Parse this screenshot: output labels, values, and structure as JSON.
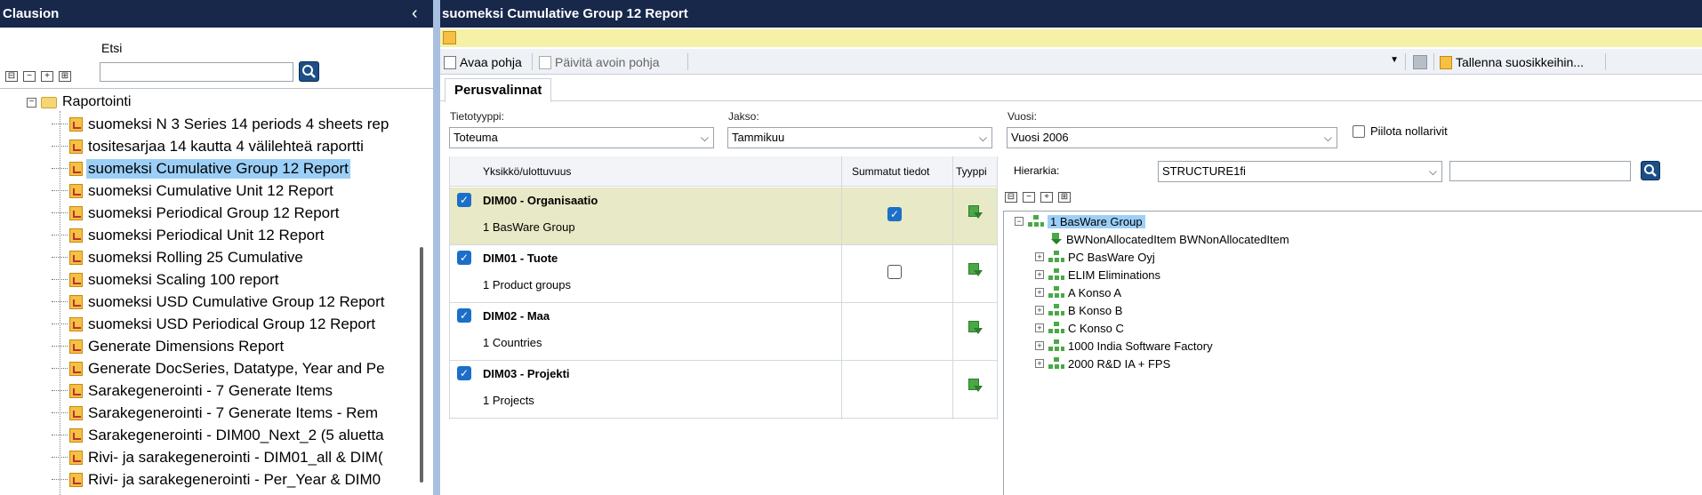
{
  "left_panel": {
    "title": "Clausion",
    "search_label": "Etsi",
    "search_value": "",
    "tree_root": "Raportointi",
    "tree_items": [
      {
        "label": "suomeksi N 3 Series 14 periods 4 sheets rep"
      },
      {
        "label": " tositesarjaa 14 kautta 4 välilehteä raportti"
      },
      {
        "label": "suomeksi Cumulative Group 12 Report",
        "selected": true
      },
      {
        "label": "suomeksi Cumulative Unit 12 Report"
      },
      {
        "label": "suomeksi Periodical Group 12 Report"
      },
      {
        "label": "suomeksi Periodical Unit 12 Report"
      },
      {
        "label": "suomeksi Rolling 25 Cumulative"
      },
      {
        "label": "suomeksi Scaling 100 report"
      },
      {
        "label": "suomeksi USD Cumulative Group 12 Report"
      },
      {
        "label": "suomeksi USD Periodical Group 12 Report"
      },
      {
        "label": "Generate Dimensions Report"
      },
      {
        "label": "Generate DocSeries, Datatype, Year and Pe"
      },
      {
        "label": "Sarakegenerointi - 7 Generate Items"
      },
      {
        "label": "Sarakegenerointi - 7 Generate Items -   Rem"
      },
      {
        "label": "Sarakegenerointi - DIM00_Next_2 (5 aluetta"
      },
      {
        "label": "Rivi- ja sarakegenerointi - DIM01_all & DIM("
      },
      {
        "label": "Rivi- ja sarakegenerointi - Per_Year & DIM0"
      }
    ]
  },
  "right_panel": {
    "title": "suomeksi Cumulative Group 12 Report",
    "toolbar": {
      "open_label": "Avaa pohja",
      "update_label": "Päivitä avoin pohja",
      "save_fav_label": "Tallenna suosikkeihin..."
    },
    "tab_label": "Perusvalinnat",
    "fields": {
      "datatype_label": "Tietotyyppi:",
      "datatype_value": "Toteuma",
      "period_label": "Jakso:",
      "period_value": "Tammikuu",
      "year_label": "Vuosi:",
      "year_value": "Vuosi 2006",
      "hide_zero_label": "Piilota nollarivit"
    },
    "grid": {
      "col_unit": "Yksikkö/ulottuvuus",
      "col_summed": "Summatut tiedot",
      "col_type": "Tyyppi",
      "rows": [
        {
          "name": "DIM00 - Organisaatio",
          "value": "1 BasWare Group",
          "checked": true,
          "summed": true
        },
        {
          "name": "DIM01 - Tuote",
          "value": "1 Product groups",
          "checked": true,
          "summed": false
        },
        {
          "name": "DIM02 - Maa",
          "value": "1 Countries",
          "checked": true,
          "summed": null
        },
        {
          "name": "DIM03 - Projekti",
          "value": "1 Projects",
          "checked": true,
          "summed": null
        }
      ]
    },
    "hierarchy": {
      "label": "Hierarkia:",
      "value": "STRUCTURE1fi",
      "search_value": "",
      "root": "1 BasWare Group",
      "children": [
        {
          "label": "BWNonAllocatedItem BWNonAllocatedItem",
          "leaf": true
        },
        {
          "label": "PC BasWare Oyj"
        },
        {
          "label": "ELIM Eliminations"
        },
        {
          "label": "A Konso A"
        },
        {
          "label": "B Konso B"
        },
        {
          "label": "C Konso C"
        },
        {
          "label": "1000 India Software Factory"
        },
        {
          "label": "2000 R&D IA + FPS"
        }
      ]
    }
  }
}
